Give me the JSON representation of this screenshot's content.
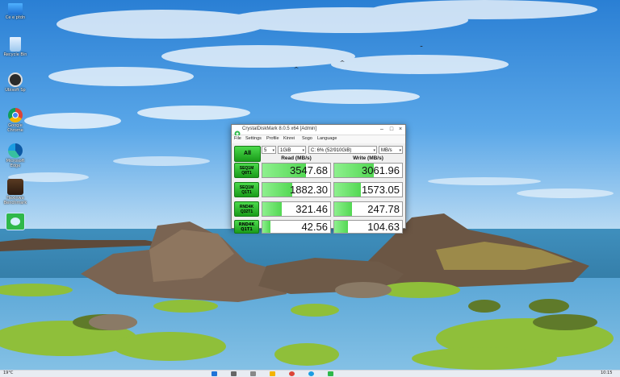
{
  "desktop": {
    "icons": [
      {
        "label": "Ce e ptdn",
        "icon": "this-pc-icon"
      },
      {
        "label": "Recycle Bin",
        "icon": "recycle-bin-icon"
      },
      {
        "label": "Ubisoft Sp",
        "icon": "app-icon"
      },
      {
        "label": "Google Chrome",
        "icon": "chrome-icon"
      },
      {
        "label": "Microsoft Edge",
        "icon": "edge-icon"
      },
      {
        "label": "Hexinwa Benchmark",
        "icon": "hexinwa-icon"
      },
      {
        "label": "",
        "icon": "crystaldiskmark-icon"
      }
    ]
  },
  "window": {
    "title": "CrystalDiskMark 8.0.5 x64 [Admin]",
    "menu": [
      "File",
      "Settings",
      "Profile",
      "Kinrei",
      "Sogo",
      "Language"
    ],
    "all_label": "All",
    "count": "5",
    "size": "1GiB",
    "drive": "C: 6% (52/910GiB)",
    "unit": "MB/s",
    "read_header": "Read (MB/s)",
    "write_header": "Write (MB/s)",
    "rows": [
      {
        "test": "SEQ1M",
        "param": "Q8T1",
        "read": "3547.68",
        "write": "3061.96",
        "read_pct": 0.64,
        "write_pct": 0.58
      },
      {
        "test": "SEQ1M",
        "param": "Q1T1",
        "read": "1882.30",
        "write": "1573.05",
        "read_pct": 0.44,
        "write_pct": 0.39
      },
      {
        "test": "RND4K",
        "param": "Q32T1",
        "read": "321.46",
        "write": "247.78",
        "read_pct": 0.28,
        "write_pct": 0.26
      },
      {
        "test": "RND4K",
        "param": "Q1T1",
        "read": "42.56",
        "write": "104.63",
        "read_pct": 0.12,
        "write_pct": 0.2
      }
    ]
  },
  "taskbar": {
    "left_text": "19°C",
    "clock": "10:15"
  }
}
